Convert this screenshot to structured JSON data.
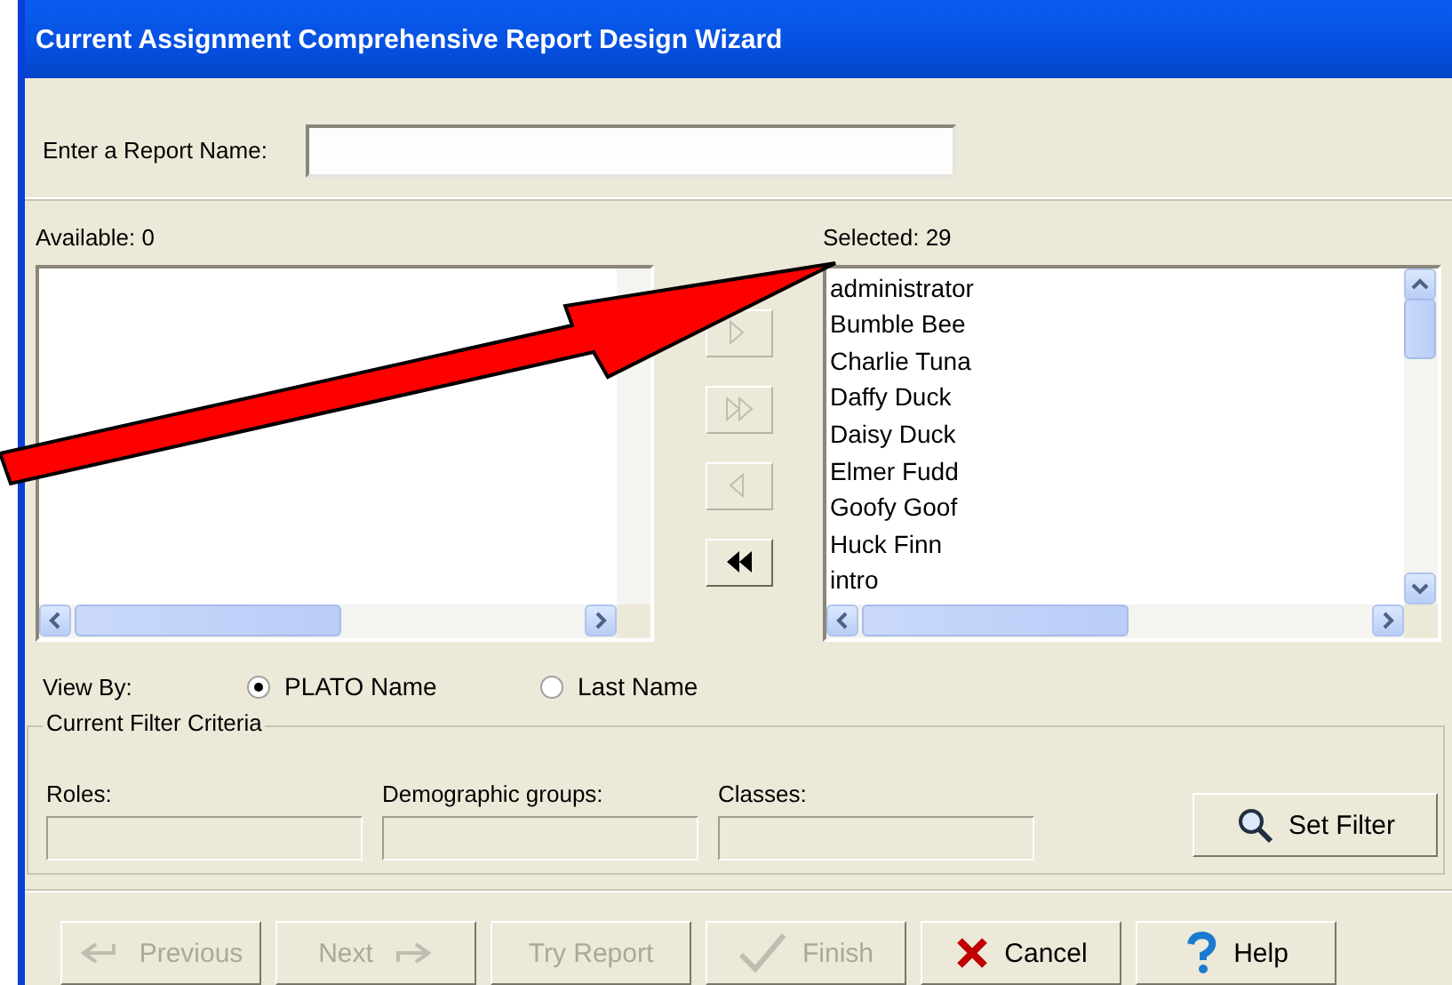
{
  "window": {
    "title": "Current Assignment Comprehensive Report Design Wizard"
  },
  "report_name": {
    "label": "Enter a Report Name:"
  },
  "available": {
    "label": "Available: 0"
  },
  "transfer_buttons": [
    {
      "kind": "add",
      "disabled": true
    },
    {
      "kind": "add_all",
      "disabled": true
    },
    {
      "kind": "remove",
      "disabled": true
    },
    {
      "kind": "remove_all",
      "disabled": false
    }
  ],
  "selected": {
    "label": "Selected: 29",
    "items": [
      "administrator",
      "Bumble Bee",
      "Charlie Tuna",
      "Daffy Duck",
      "Daisy Duck",
      "Elmer Fudd",
      "Goofy Goof",
      "Huck Finn",
      "intro"
    ]
  },
  "view_by": {
    "label": "View By:",
    "options": [
      {
        "label": "PLATO Name",
        "selected": true
      },
      {
        "label": "Last Name",
        "selected": false
      }
    ]
  },
  "filter": {
    "title": "Current Filter Criteria",
    "fields": [
      {
        "label": "Roles:"
      },
      {
        "label": "Demographic groups:"
      },
      {
        "label": "Classes:"
      }
    ],
    "button": "Set Filter"
  },
  "buttons": [
    {
      "kind": "previous",
      "label": "Previous",
      "disabled": true
    },
    {
      "kind": "next",
      "label": "Next",
      "disabled": true
    },
    {
      "kind": "try",
      "label": "Try Report",
      "disabled": true
    },
    {
      "kind": "finish",
      "label": "Finish",
      "disabled": true
    },
    {
      "kind": "cancel",
      "label": "Cancel",
      "disabled": false
    },
    {
      "kind": "help",
      "label": "Help",
      "disabled": false
    }
  ]
}
